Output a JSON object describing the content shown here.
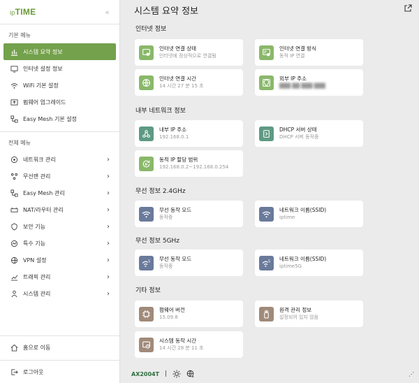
{
  "brand": {
    "prefix": "ip",
    "name": "TIME"
  },
  "sidebar": {
    "collapse_glyph": "«",
    "basic_label": "기본 메뉴",
    "basic_items": [
      {
        "label": "시스템 요약 정보",
        "icon": "chart-icon",
        "active": true
      },
      {
        "label": "인터넷 설정 정보",
        "icon": "monitor-icon"
      },
      {
        "label": "WiFi 기본 설정",
        "icon": "wifi-icon"
      },
      {
        "label": "펌웨어 업그레이드",
        "icon": "upgrade-icon"
      },
      {
        "label": "Easy Mesh 기본 설정",
        "icon": "mesh-icon"
      }
    ],
    "all_label": "전체 메뉴",
    "all_items": [
      {
        "label": "네트워크 관리",
        "icon": "network-icon"
      },
      {
        "label": "무선랜 관리",
        "icon": "wireless-icon"
      },
      {
        "label": "Easy Mesh 관리",
        "icon": "mesh-icon"
      },
      {
        "label": "NAT/라우터 관리",
        "icon": "router-icon"
      },
      {
        "label": "보안 기능",
        "icon": "shield-icon"
      },
      {
        "label": "특수 기능",
        "icon": "special-icon"
      },
      {
        "label": "VPN 설정",
        "icon": "vpn-icon"
      },
      {
        "label": "트래픽 관리",
        "icon": "traffic-icon"
      },
      {
        "label": "시스템 관리",
        "icon": "system-icon"
      }
    ],
    "home_label": "홈으로 이동",
    "logout_label": "로그아웃"
  },
  "main": {
    "title": "시스템 요약 정보",
    "groups": [
      {
        "title": "인터넷 정보"
      },
      {
        "title": "내부 네트워크 정보"
      },
      {
        "title": "무선 정보 2.4GHz"
      },
      {
        "title": "무선 정보 5GHz"
      },
      {
        "title": "기타 정보"
      }
    ],
    "cards": {
      "inet_status": {
        "title": "인터넷 연결 상태",
        "sub": "인터넷에 정상적으로 연결됨"
      },
      "inet_method": {
        "title": "인터넷 연결 방식",
        "sub": "동적 IP 연결"
      },
      "inet_time": {
        "title": "인터넷 연결 시간",
        "sub": "14 시간 27 분 15 초"
      },
      "ext_ip": {
        "title": "외부 IP 주소",
        "sub": "███ ██ ███ ███"
      },
      "int_ip": {
        "title": "내부 IP 주소",
        "sub": "192.168.0.1"
      },
      "dhcp": {
        "title": "DHCP 서버 상태",
        "sub": "DHCP 서버 동작중"
      },
      "dyn_range": {
        "title": "동적 IP 할당 범위",
        "sub": "192.168.0.2~192.168.0.254"
      },
      "w24_mode": {
        "title": "무선 동작 모드",
        "sub": "동작중"
      },
      "w24_ssid": {
        "title": "네트워크 이름(SSID)",
        "sub": "iptime"
      },
      "w5_mode": {
        "title": "무선 동작 모드",
        "sub": "동작중"
      },
      "w5_ssid": {
        "title": "네트워크 이름(SSID)",
        "sub": "iptime5G"
      },
      "fw": {
        "title": "펌웨어 버전",
        "sub": "15.09.8"
      },
      "remote": {
        "title": "원격 관리 정보",
        "sub": "설정되어 있지 않음"
      },
      "sys_time": {
        "title": "시스템 동작 시간",
        "sub": "14 시간 28 분 11 초"
      }
    },
    "wifi_badge_5g": "5"
  },
  "footer": {
    "model": "AX2004T",
    "separator": "|",
    "more_glyph": "⋰"
  },
  "colors": {
    "accent": "#74a14b",
    "green_icon": "#8ab86a",
    "teal_icon": "#5e9a83",
    "blue_icon": "#6a7a9b",
    "brown_icon": "#a08a7a"
  }
}
